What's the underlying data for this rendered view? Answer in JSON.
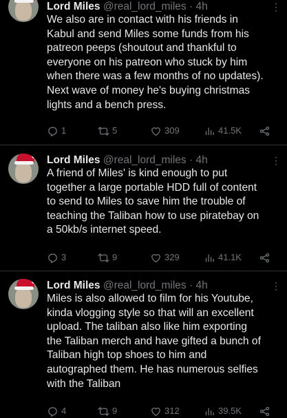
{
  "tweets": [
    {
      "name": "Lord Miles",
      "handle": "@real_lord_miles",
      "time": "4h",
      "text": "We also are in contact with his friends in\nKabul and send Miles some funds from his\npatreon peeps (shoutout and thankful to\neveryone on his patreon who stuck by him\nwhen there was a few months of no updates).\nNext wave of money he's buying christmas\nlights and a bench press.",
      "replies": "1",
      "retweets": "5",
      "likes": "309",
      "views": "41.5K"
    },
    {
      "name": "Lord Miles",
      "handle": "@real_lord_miles",
      "time": "4h",
      "text": "A friend of Miles' is kind enough to put\ntogether a large portable HDD full of content\nto send to Miles to save him the trouble of\nteaching the Taliban how to use piratebay on\na 50kb/s internet speed.",
      "replies": "3",
      "retweets": "9",
      "likes": "329",
      "views": "41.1K"
    },
    {
      "name": "Lord Miles",
      "handle": "@real_lord_miles",
      "time": "4h",
      "text": "Miles is also allowed to film for his Youtube,\nkinda vlogging style so that will an excellent\nupload. The taliban also like him exporting\nthe Taliban merch and have gifted a bunch of\nTaliban high top shoes to him and\nautographed them. He has numerous selfies\nwith the Taliban",
      "replies": "4",
      "retweets": "9",
      "likes": "312",
      "views": "39.5K"
    }
  ],
  "icons": {
    "reply": "reply-icon",
    "retweet": "retweet-icon",
    "like": "heart-icon",
    "views": "views-icon",
    "share": "share-icon",
    "more": "more-icon"
  },
  "colors": {
    "background": "#000000",
    "text": "#e7e9ea",
    "muted": "#71767b",
    "divider": "#2f3336"
  }
}
